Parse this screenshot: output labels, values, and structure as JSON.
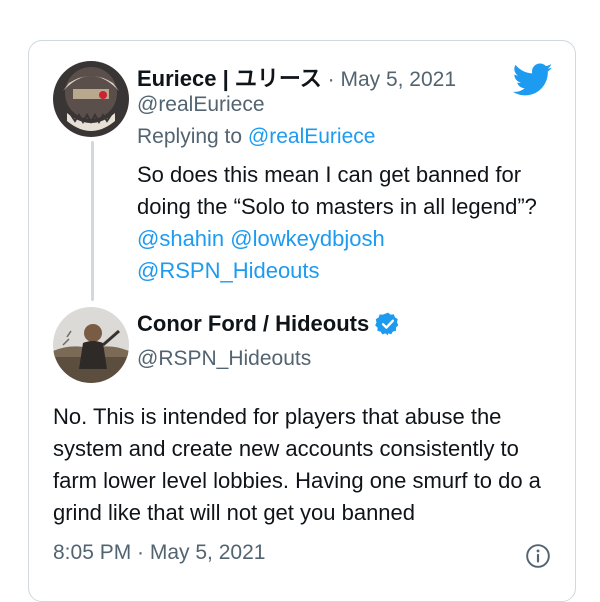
{
  "colors": {
    "accent": "#1d9bf0",
    "muted": "#536471",
    "border": "#cfd9de"
  },
  "parent": {
    "display_name": "Euriece | ユリース",
    "separator": " · ",
    "date": "May 5, 2021",
    "handle": "@realEuriece",
    "replying_label": "Replying to ",
    "replying_handle": "@realEuriece",
    "text_plain": "So does this mean I can get banned for doing the “Solo to masters in all legend”? ",
    "mentions": [
      "@shahin",
      "@lowkeydbjosh",
      "@RSPN_Hideouts"
    ]
  },
  "reply": {
    "display_name": "Conor Ford / Hideouts",
    "handle": "@RSPN_Hideouts",
    "text": "No. This is intended for players that abuse the system and create new accounts consistently to farm lower level lobbies. Having one smurf to do a grind like that will not get you banned",
    "timestamp": "8:05 PM · May 5, 2021"
  },
  "icons": {
    "brand": "twitter-bird-icon",
    "verified": "verified-badge-icon",
    "info": "info-icon"
  }
}
